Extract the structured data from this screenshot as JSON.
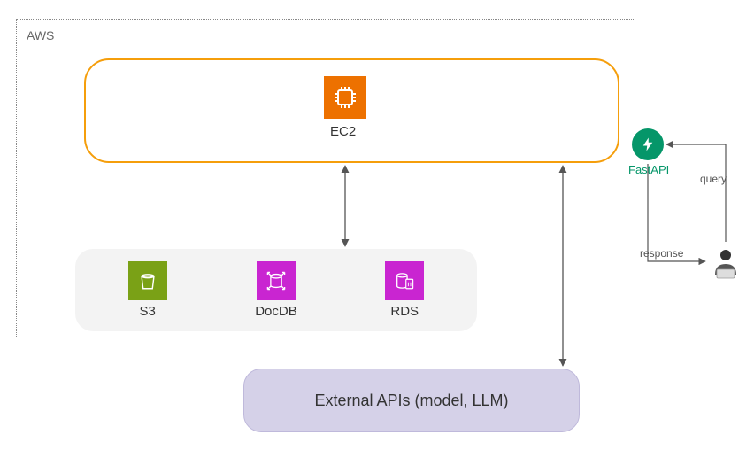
{
  "container": {
    "label": "AWS"
  },
  "compute": {
    "ec2_label": "EC2"
  },
  "storage": {
    "s3_label": "S3",
    "docdb_label": "DocDB",
    "rds_label": "RDS"
  },
  "external": {
    "label": "External APIs (model, LLM)"
  },
  "api": {
    "fastapi_label": "FastAPI"
  },
  "flows": {
    "query_label": "query",
    "response_label": "response"
  }
}
